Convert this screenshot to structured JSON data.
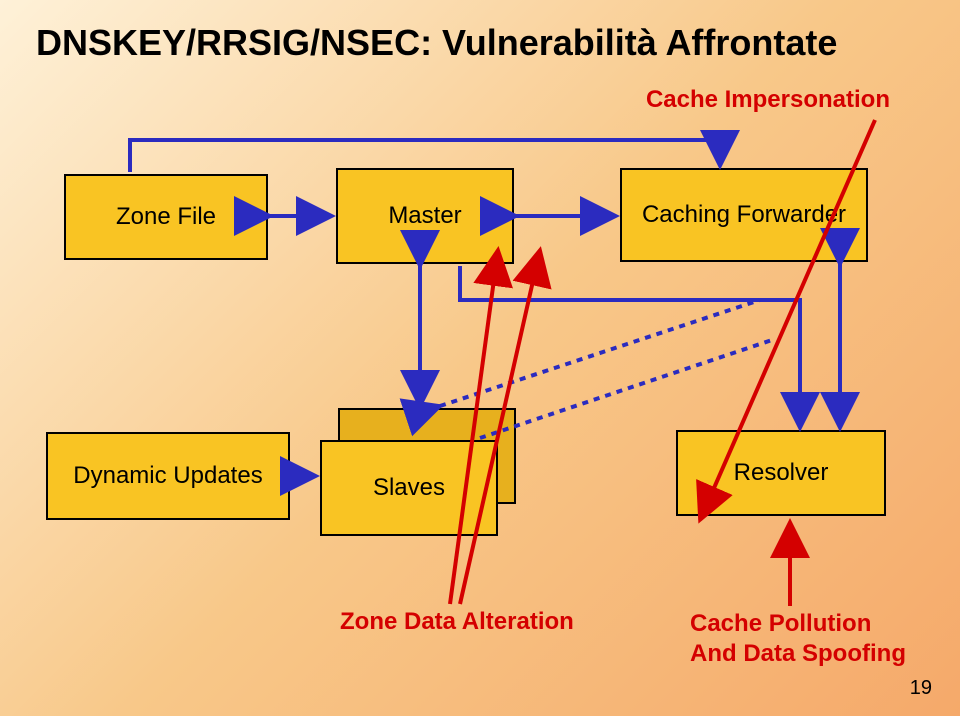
{
  "title": "DNSKEY/RRSIG/NSEC: Vulnerabilità Affrontate",
  "labels": {
    "cache_impersonation": "Cache Impersonation",
    "zone_data_alteration": "Zone Data Alteration",
    "cache_pollution": "Cache Pollution",
    "data_spoofing": "And Data Spoofing"
  },
  "boxes": {
    "zone_file": "Zone File",
    "master": "Master",
    "caching_forwarder": "Caching Forwarder",
    "dynamic_updates": "Dynamic Updates",
    "slaves": "Slaves",
    "resolver": "Resolver"
  },
  "page_number": "19"
}
